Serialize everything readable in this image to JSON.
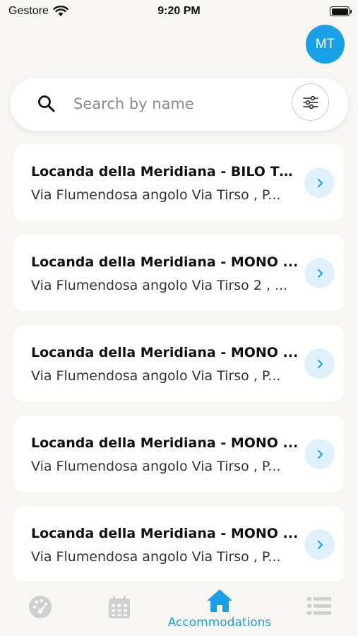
{
  "status_bar": {
    "carrier": "Gestore",
    "time": "9:20 PM"
  },
  "avatar": {
    "initials": "MT",
    "color": "#1aa0e6"
  },
  "search": {
    "placeholder": "Search by name",
    "value": ""
  },
  "accommodations": [
    {
      "title": "Locanda della Meridiana - BILO TE...",
      "address": "Via Flumendosa angolo Via Tirso , P..."
    },
    {
      "title": "Locanda della Meridiana - MONO ...",
      "address": "Via Flumendosa angolo Via Tirso 2 , ..."
    },
    {
      "title": "Locanda della Meridiana - MONO ...",
      "address": "Via Flumendosa angolo Via Tirso , P..."
    },
    {
      "title": "Locanda della Meridiana - MONO ...",
      "address": "Via Flumendosa angolo Via Tirso , P..."
    },
    {
      "title": "Locanda della Meridiana - MONO ...",
      "address": "Via Flumendosa angolo Via Tirso , P..."
    }
  ],
  "tab_bar": {
    "active_color": "#1aa0e6",
    "inactive_color": "#cfcfcf",
    "tabs": [
      {
        "icon": "dashboard-icon",
        "label": ""
      },
      {
        "icon": "calendar-icon",
        "label": ""
      },
      {
        "icon": "home-icon",
        "label": "Accommodations",
        "active": true
      },
      {
        "icon": "list-icon",
        "label": ""
      }
    ]
  }
}
